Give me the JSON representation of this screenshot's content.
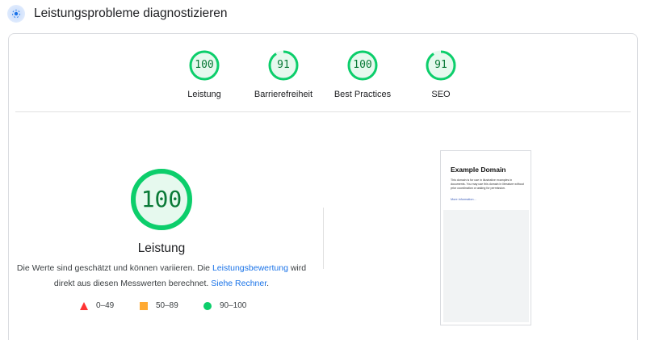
{
  "header": {
    "title": "Leistungsprobleme diagnostizieren",
    "icon": "lighthouse-icon"
  },
  "colors": {
    "pass": "#0cce6b",
    "pass_text": "#0a7a37",
    "average": "#ffaa33",
    "fail": "#ff3333",
    "link": "#1a73e8"
  },
  "categories": [
    {
      "label": "Leistung",
      "score": "100",
      "fraction": 1.0
    },
    {
      "label": "Barrierefreiheit",
      "score": "91",
      "fraction": 0.91
    },
    {
      "label": "Best Practices",
      "score": "100",
      "fraction": 1.0
    },
    {
      "label": "SEO",
      "score": "91",
      "fraction": 0.91
    }
  ],
  "performance": {
    "score": "100",
    "fraction": 1.0,
    "title": "Leistung",
    "desc_part1": "Die Werte sind geschätzt und können variieren. Die ",
    "desc_link1": "Leistungsbewertung",
    "desc_part2": " wird direkt aus diesen Messwerten berechnet. ",
    "desc_link2": "Siehe Rechner",
    "desc_part3": "."
  },
  "legend": [
    {
      "range": "0–49",
      "shape": "triangle",
      "color": "#ff3333"
    },
    {
      "range": "50–89",
      "shape": "square",
      "color": "#ffaa33"
    },
    {
      "range": "90–100",
      "shape": "circle",
      "color": "#0cce6b"
    }
  ],
  "preview": {
    "title": "Example Domain",
    "body": "This domain is for use in illustrative examples in documents. You may use this domain in literature without prior coordination or asking for permission.",
    "link": "More information..."
  }
}
